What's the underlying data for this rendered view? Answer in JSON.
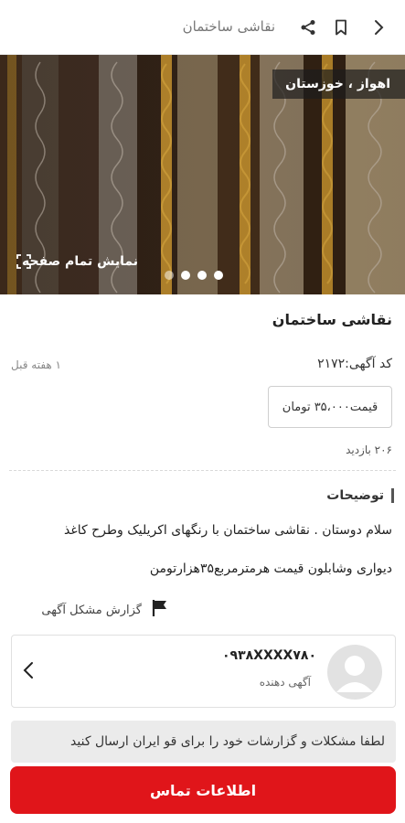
{
  "header": {
    "title": "نقاشی ساختمان",
    "icons": [
      "share-icon",
      "bookmark-icon",
      "chevron-right-icon"
    ]
  },
  "gallery": {
    "location": "اهواز ، خوزستان",
    "fullscreen_label": "نمایش تمام صفحه",
    "slide_count": 4,
    "active_slide": 4
  },
  "ad": {
    "title": "نقاشی ساختمان",
    "code": "کد آگهی:۲۱۷۲",
    "posted": "۱ هفته قبل",
    "price": "قیمت۳۵،۰۰۰ تومان",
    "views": "۲۰۶ بازدید"
  },
  "description": {
    "heading": "توضیحات",
    "lines": [
      "سلام دوستان . نقاشی ساختمان با رنگهای اکریلیک وطرح کاغذ",
      "دیواری وشابلون قیمت هرمترمربع۳۵هزارتومن"
    ]
  },
  "report": {
    "label": "گزارش مشکل آگهی"
  },
  "seller": {
    "phone": "۰۹۳۸XXXX۷۸۰",
    "role": "آگهی دهنده"
  },
  "notice": {
    "text": "لطفا مشکلات و گزارشات خود را برای قو ایران ارسال کنید"
  },
  "cta": {
    "label": "اطلاعات تماس"
  },
  "colors": {
    "accent": "#e0151a",
    "hero_bg": "#2a1a10"
  }
}
